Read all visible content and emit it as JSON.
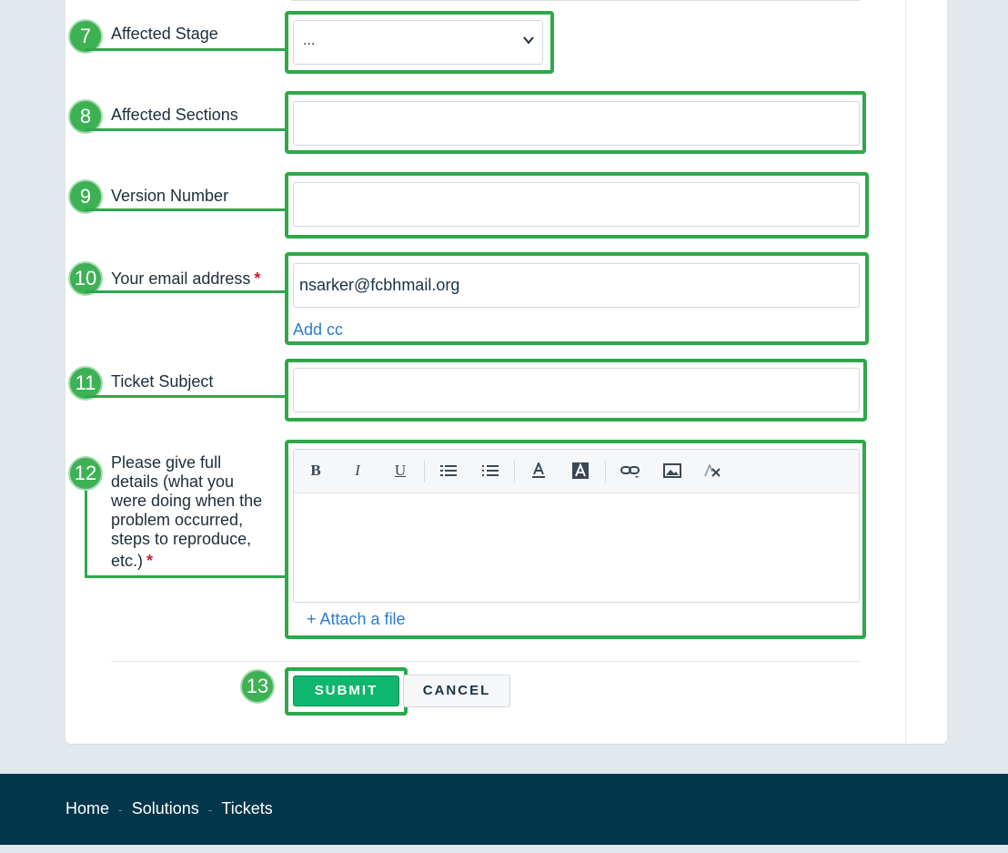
{
  "form": {
    "fields": [
      {
        "step": "7",
        "label": "Affected Stage",
        "value": "...",
        "required": false
      },
      {
        "step": "8",
        "label": "Affected Sections",
        "value": "",
        "required": false
      },
      {
        "step": "9",
        "label": "Version Number",
        "value": "",
        "required": false
      },
      {
        "step": "10",
        "label": "Your email address",
        "value": "nsarker@fcbhmail.org",
        "required": true,
        "extra_link": "Add cc"
      },
      {
        "step": "11",
        "label": "Ticket Subject",
        "value": "",
        "required": false
      },
      {
        "step": "12",
        "label_lines": [
          "Please give full",
          "details (what you",
          "were doing when the",
          "problem occurred,",
          "steps to reproduce,",
          "etc.)"
        ],
        "required": true,
        "attach_link": "+ Attach a file"
      }
    ],
    "required_mark": "*",
    "editor_toolbar": [
      "B",
      "I",
      "U",
      "bulleted-list-icon",
      "numbered-list-icon",
      "font-color-icon",
      "background-color-icon",
      "link-icon",
      "image-icon",
      "clear-format-icon"
    ],
    "submit_step": "13",
    "submit_label": "SUBMIT",
    "cancel_label": "CANCEL"
  },
  "footer": {
    "links": [
      "Home",
      "Solutions",
      "Tickets"
    ],
    "separator": "-"
  },
  "colors": {
    "highlight": "#2ea84a",
    "badge": "#3eb155",
    "submit": "#0fb66e",
    "footer": "#02364a",
    "link": "#2c7cd0",
    "required": "#d21f26"
  }
}
